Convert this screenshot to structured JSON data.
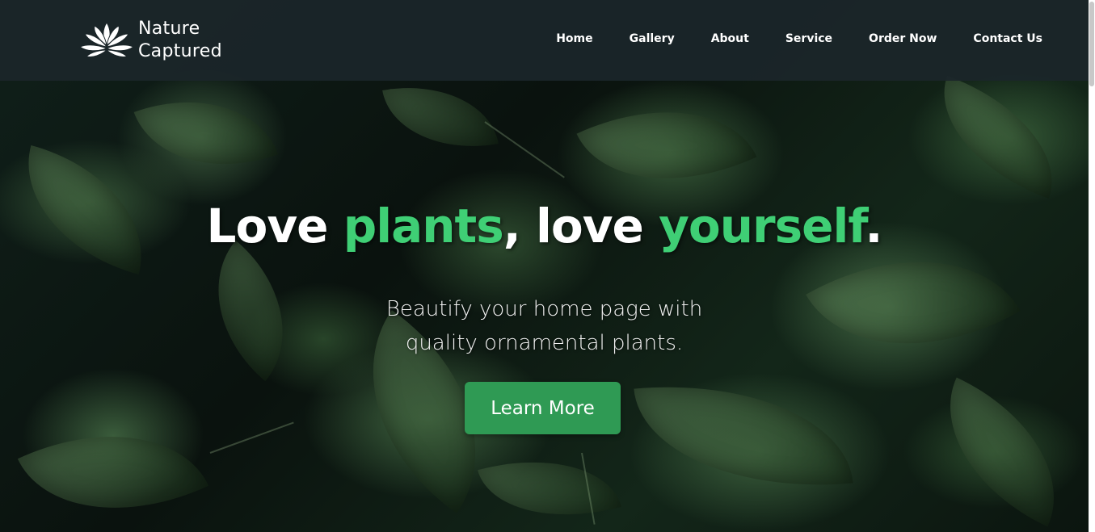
{
  "brand": {
    "logo_icon": "leaf-logo-icon",
    "line1": "Nature",
    "line2": "Captured"
  },
  "nav": {
    "items": [
      {
        "label": "Home"
      },
      {
        "label": "Gallery"
      },
      {
        "label": "About"
      },
      {
        "label": "Service"
      },
      {
        "label": "Order Now"
      },
      {
        "label": "Contact Us"
      }
    ]
  },
  "hero": {
    "headline": {
      "part1": "Love ",
      "accent1": "plants",
      "part2": ", love ",
      "accent2": "yourself",
      "part3": "."
    },
    "subtitle_line1": "Beautify your home page with",
    "subtitle_line2": "quality ornamental plants.",
    "cta_label": "Learn More"
  },
  "colors": {
    "accent": "#3fcf75",
    "button": "#2f9a54",
    "header_bg": "#1b262a"
  }
}
